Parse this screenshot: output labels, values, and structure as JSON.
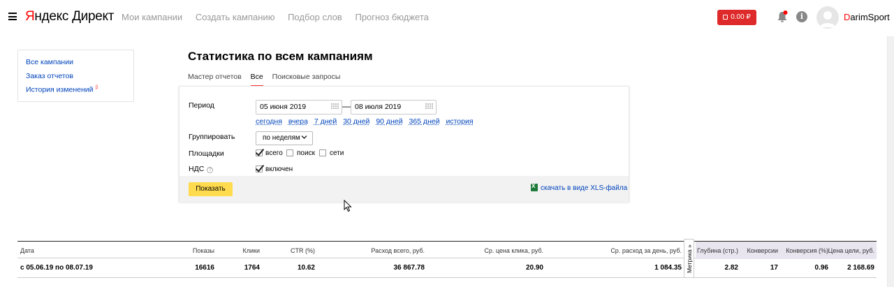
{
  "header": {
    "logo_ya_first": "Я",
    "logo_ya_rest": "ндекс",
    "logo_product": "Директ",
    "nav": [
      "Мои кампании",
      "Создать кампанию",
      "Подбор слов",
      "Прогноз бюджета"
    ],
    "balance": "0.00 ₽",
    "user_first": "D",
    "user_rest": "arimSport",
    "info_glyph": "i"
  },
  "sidebar": {
    "items": [
      {
        "label": "Все кампании"
      },
      {
        "label": "Заказ отчетов"
      },
      {
        "label": "История изменений",
        "badge": "β"
      }
    ]
  },
  "page": {
    "title": "Статистика по всем кампаниям",
    "tabs": [
      {
        "label": "Мастер отчетов",
        "active": false
      },
      {
        "label": "Все",
        "active": true
      },
      {
        "label": "Поисковые запросы",
        "active": false
      }
    ]
  },
  "form": {
    "period_label": "Период",
    "date_from": "05 июня 2019",
    "date_to": "08 июля 2019",
    "dash": "—",
    "quick": [
      "сегодня",
      "вчера",
      "7 дней",
      "30 дней",
      "90 дней",
      "365 дней",
      "история"
    ],
    "group_label": "Группировать",
    "group_value": "по неделям",
    "places_label": "Площадки",
    "places": [
      {
        "label": "всего",
        "checked": true
      },
      {
        "label": "поиск",
        "checked": false
      },
      {
        "label": "сети",
        "checked": false
      }
    ],
    "vat_label": "НДС",
    "vat_help": "?",
    "vat_option": "включен",
    "vat_checked": true,
    "show_button": "Показать",
    "xls_link": "скачать в виде XLS-файла"
  },
  "table": {
    "headers": [
      "Дата",
      "Показы",
      "Клики",
      "CTR (%)",
      "Расход всего, руб.",
      "Ср. цена клика, руб.",
      "Ср. расход за день, руб.",
      "Глубина (стр.)",
      "Конверсии",
      "Конверсия (%)",
      "Цена цели, руб."
    ],
    "row": [
      "с 05.06.19 по 08.07.19",
      "16616",
      "1764",
      "10.62",
      "36 867.78",
      "20.90",
      "1 084.35",
      "2.82",
      "17",
      "0.96",
      "2 168.69"
    ],
    "metrika_tab": "Метрика »"
  },
  "colors": {
    "accent_red": "#de2a2a",
    "link": "#0044bb",
    "button_yellow": "#ffdb4d",
    "metrika_shade": "#e8e5ef"
  }
}
